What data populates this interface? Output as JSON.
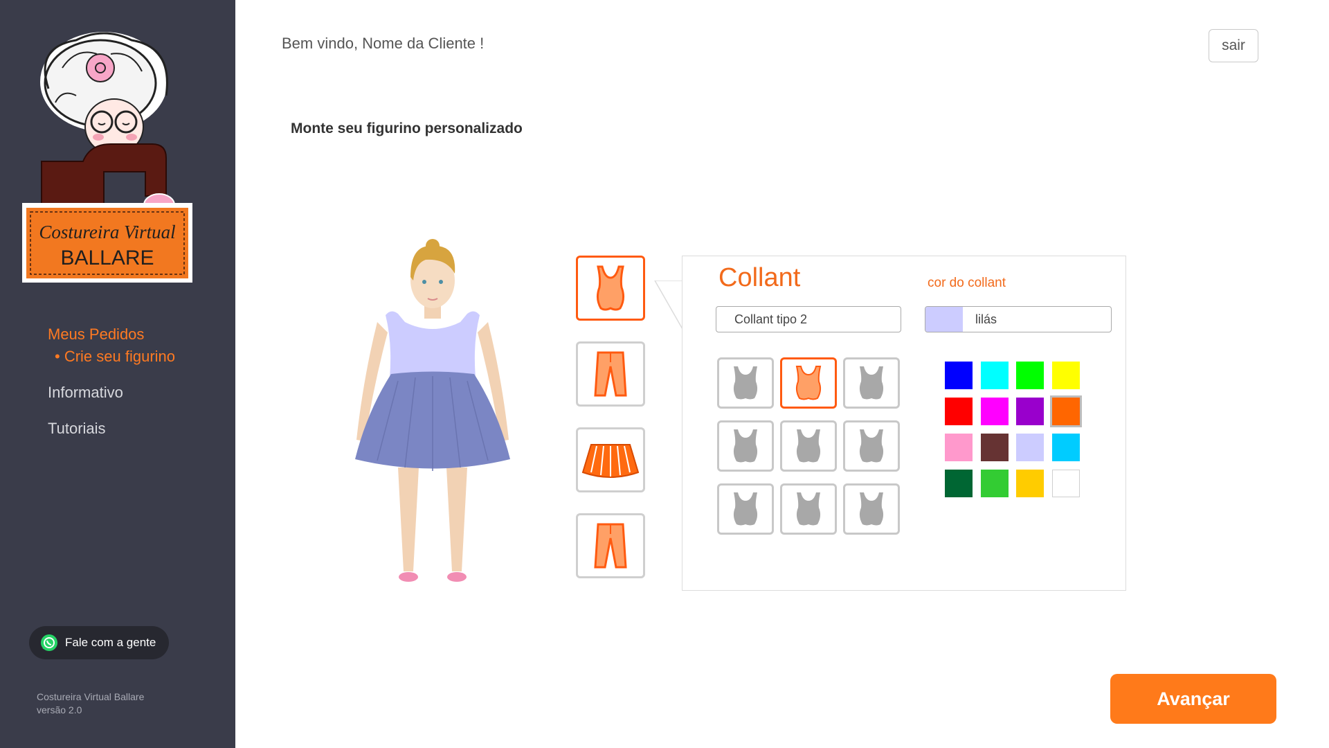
{
  "logo": {
    "line1": "Costureira Virtual",
    "line2": "BALLARE"
  },
  "nav": {
    "items": [
      {
        "label": "Meus Pedidos"
      },
      {
        "label": "• Crie seu figurino"
      },
      {
        "label": "Informativo"
      },
      {
        "label": "Tutoriais"
      }
    ]
  },
  "whatsapp": {
    "label": "Fale com a gente",
    "icon": "whatsapp-icon"
  },
  "footer": {
    "line1": "Costureira Virtual Ballare",
    "line2": "versão 2.0"
  },
  "header": {
    "welcome": "Bem vindo, Nome da Cliente !",
    "logout_label": "sair"
  },
  "main": {
    "heading": "Monte seu figurino personalizado"
  },
  "categories": [
    {
      "name": "collant",
      "icon": "leotard-icon",
      "selected": true
    },
    {
      "name": "calca",
      "icon": "pants-icon",
      "selected": false
    },
    {
      "name": "saia",
      "icon": "tutu-skirt-icon",
      "selected": false
    },
    {
      "name": "calca-2",
      "icon": "pants-icon",
      "selected": false
    }
  ],
  "panel": {
    "title": "Collant",
    "color_title": "cor do collant",
    "type_value": "Collant tipo 2",
    "color_value": "lilás",
    "color_value_hex": "#ccccff",
    "selected_type_index": 1,
    "type_count": 9
  },
  "palette": {
    "colors": [
      "#0000ff",
      "#00ffff",
      "#00ff00",
      "#ffff00",
      "#ff0000",
      "#ff00ff",
      "#9900cc",
      "#ff6600",
      "#ff99cc",
      "#663333",
      "#ccccff",
      "#00ccff",
      "#006633",
      "#33cc33",
      "#ffcc00",
      "#ffffff"
    ],
    "selected_index": 7
  },
  "colors": {
    "accent": "#ff7a1a",
    "sidebar": "#3a3c4a",
    "leotard": "#ccccff",
    "skirt": "#7b86c4"
  },
  "actions": {
    "next_label": "Avançar"
  }
}
